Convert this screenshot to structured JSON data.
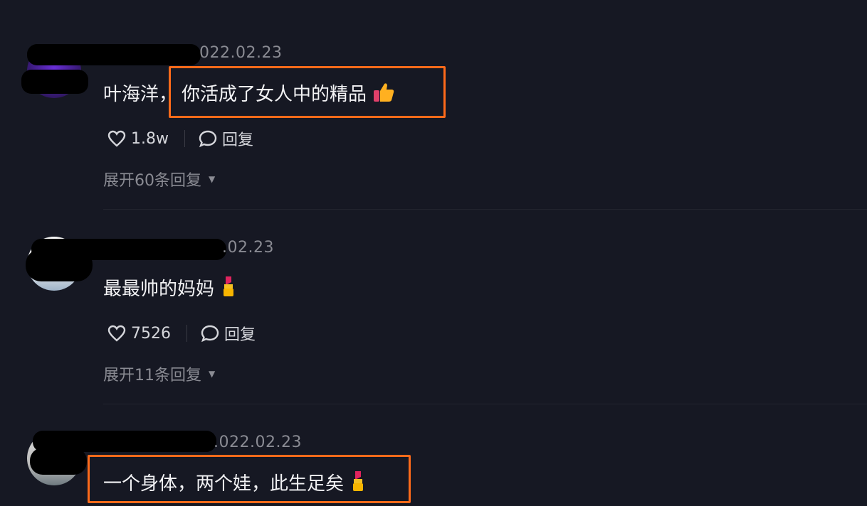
{
  "comments": [
    {
      "date": "022.02.23",
      "text_prefix": "叶海洋，",
      "text_highlight": "你活成了女人中的精品",
      "emoji": "thumbs-up-icon",
      "likes": "1.8w",
      "reply_label": "回复",
      "expand_label": "展开60条回复"
    },
    {
      "date": ".02.23",
      "text": "最最帅的妈妈",
      "emoji": "lipstick-icon",
      "likes": "7526",
      "reply_label": "回复",
      "expand_label": "展开11条回复"
    },
    {
      "date": ".022.02.23",
      "text_highlight": "一个身体，两个娃，此生足矣",
      "emoji": "lipstick-icon"
    }
  ],
  "colors": {
    "background": "#161823",
    "highlight_border": "#ff6a1a",
    "muted_text": "#8a8b93"
  }
}
